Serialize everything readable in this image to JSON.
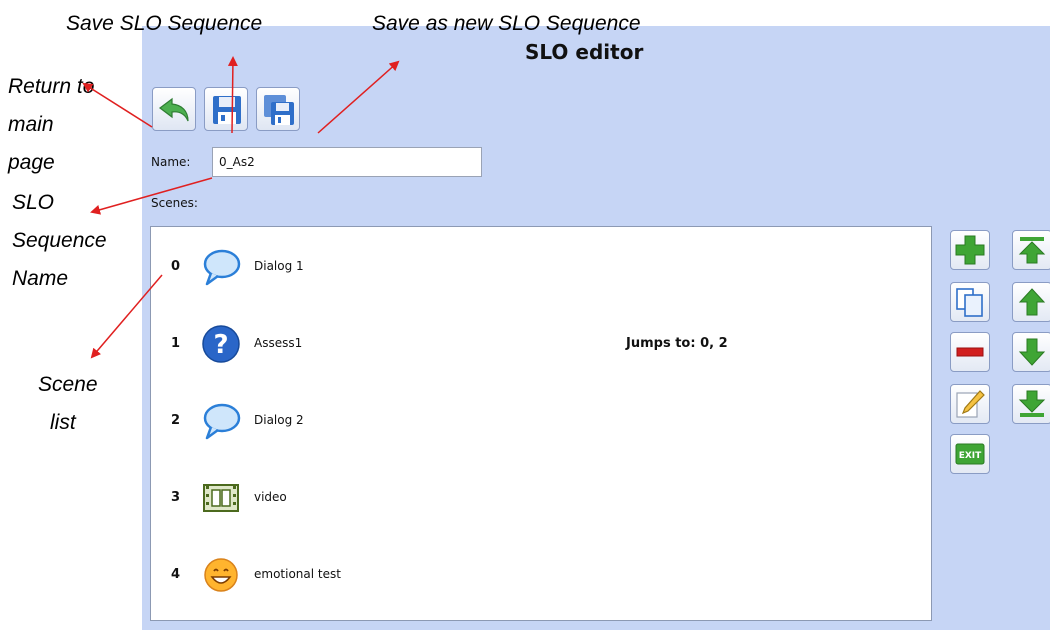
{
  "editor": {
    "title": "SLO editor",
    "name_label": "Name:",
    "name_value": "0_As2",
    "scenes_label": "Scenes:"
  },
  "toolbar": [
    {
      "icon": "return-arrow-icon",
      "color": "#4caf50"
    },
    {
      "icon": "floppy-disk-icon",
      "color": "#2f6fc9"
    },
    {
      "icon": "floppy-disk-stack-icon",
      "color": "#2f6fc9"
    }
  ],
  "scenes": [
    {
      "index": "0",
      "icon": "speech-bubble-icon",
      "name": "Dialog 1",
      "jumps": ""
    },
    {
      "index": "1",
      "icon": "question-mark-icon",
      "name": "Assess1",
      "jumps": "Jumps to:  0, 2"
    },
    {
      "index": "2",
      "icon": "speech-bubble-icon",
      "name": "Dialog 2",
      "jumps": ""
    },
    {
      "index": "3",
      "icon": "film-strip-icon",
      "name": "video",
      "jumps": ""
    },
    {
      "index": "4",
      "icon": "smiley-face-icon",
      "name": "emotional test",
      "jumps": ""
    }
  ],
  "scene_buttons": {
    "left": [
      "plus-icon",
      "copy-icon",
      "minus-icon",
      "pencil-icon",
      "exit-icon"
    ],
    "right": [
      "move-top-icon",
      "move-up-icon",
      "move-down-icon",
      "move-bottom-icon"
    ],
    "exit_label": "EXIT"
  },
  "annotations": {
    "save": "Save SLO Sequence",
    "save_new": "Save as new SLO Sequence",
    "return_line1": "Return  to",
    "return_line2": "main",
    "return_line3": "page",
    "name_line1": "SLO",
    "name_line2": "Sequence",
    "name_line3": "Name",
    "scene_line1": "Scene",
    "scene_line2": "list"
  },
  "colors": {
    "panel_bg": "#c6d5f5",
    "arrow": "#e02020",
    "green": "#3fa535",
    "blue": "#2f6fc9",
    "red": "#d11f1f"
  }
}
